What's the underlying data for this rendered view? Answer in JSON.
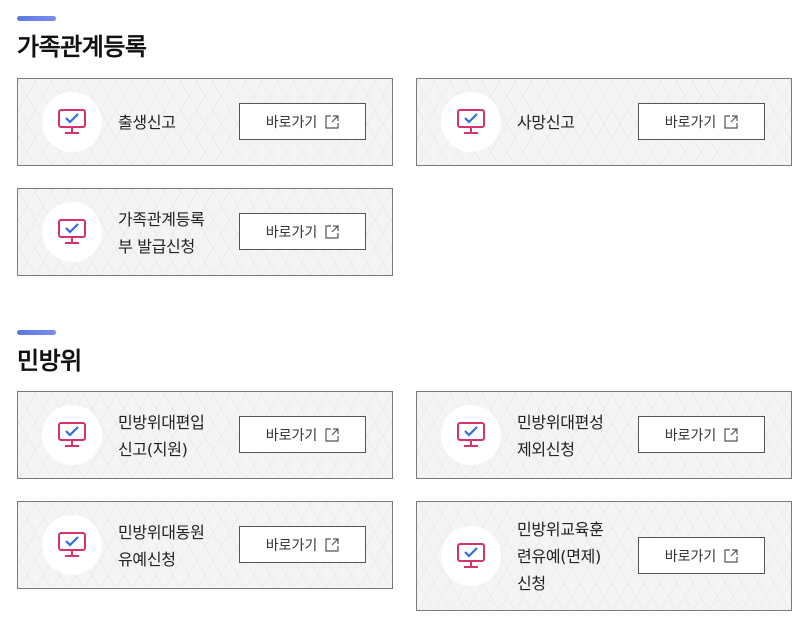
{
  "sections": [
    {
      "title": "가족관계등록",
      "cards": [
        {
          "label": "출생신고",
          "button": "바로가기"
        },
        {
          "label": "사망신고",
          "button": "바로가기"
        },
        {
          "label": "가족관계등록\n부 발급신청",
          "button": "바로가기"
        }
      ]
    },
    {
      "title": "민방위",
      "cards": [
        {
          "label": "민방위대편입\n신고(지원)",
          "button": "바로가기"
        },
        {
          "label": "민방위대편성\n제외신청",
          "button": "바로가기"
        },
        {
          "label": "민방위대동원\n유예신청",
          "button": "바로가기"
        },
        {
          "label": "민방위교육훈\n련유예(면제)\n신청",
          "button": "바로가기"
        }
      ]
    }
  ],
  "icons": {
    "card_icon": "monitor-check-icon",
    "button_icon": "external-link-icon"
  },
  "colors": {
    "accent": "#5a7be0",
    "icon_pink": "#d6336c",
    "icon_blue": "#2f6fd6"
  }
}
